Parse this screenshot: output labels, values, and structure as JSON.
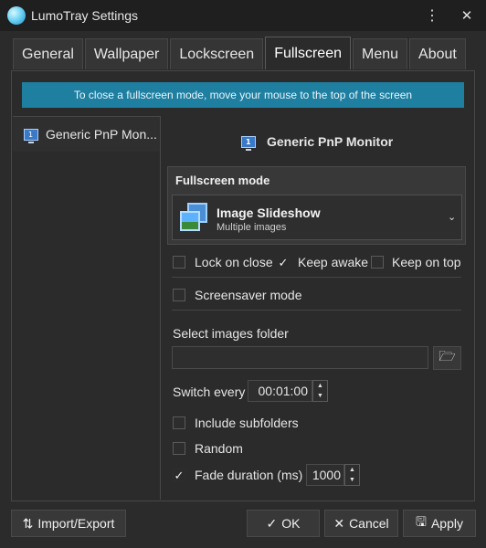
{
  "window": {
    "title": "LumoTray Settings"
  },
  "titlebar": {
    "menu_glyph": "⋮",
    "close_glyph": "✕"
  },
  "tabs": [
    {
      "label": "General"
    },
    {
      "label": "Wallpaper"
    },
    {
      "label": "Lockscreen"
    },
    {
      "label": "Fullscreen",
      "active": true
    },
    {
      "label": "Menu"
    },
    {
      "label": "About"
    }
  ],
  "banner": {
    "text": "To close a fullscreen mode, move your mouse to the top of the screen"
  },
  "monitor_list": {
    "items": [
      {
        "label": "Generic PnP Mon...",
        "badge": "1"
      }
    ]
  },
  "monitor_heading": {
    "label": "Generic PnP Monitor",
    "badge": "1"
  },
  "fullscreen_mode": {
    "group_title": "Fullscreen mode",
    "selected_title": "Image Slideshow",
    "selected_subtitle": "Multiple images",
    "arrow": "⌄"
  },
  "options": {
    "lock_on_close": {
      "label": "Lock on close",
      "checked": false
    },
    "keep_awake": {
      "label": "Keep awake",
      "checked": true
    },
    "keep_on_top": {
      "label": "Keep on top",
      "checked": false
    },
    "screensaver_mode": {
      "label": "Screensaver mode",
      "checked": false
    }
  },
  "images_folder": {
    "label": "Select images folder",
    "value": "",
    "browse_glyph": "🗁"
  },
  "switch_every": {
    "label": "Switch every",
    "value": "00:01:00"
  },
  "include_subfolders": {
    "label": "Include subfolders",
    "checked": false
  },
  "random": {
    "label": "Random",
    "checked": false
  },
  "fade_duration": {
    "label": "Fade duration (ms)",
    "checked": true,
    "value": "1000"
  },
  "footer": {
    "import_export": {
      "label": "Import/Export",
      "glyph": "⇅"
    },
    "ok": {
      "label": "OK",
      "glyph": "✓"
    },
    "cancel": {
      "label": "Cancel",
      "glyph": "✕"
    },
    "apply": {
      "label": "Apply",
      "glyph": "🖫"
    }
  },
  "check_glyph": "✓",
  "spin_up": "▲",
  "spin_down": "▼"
}
